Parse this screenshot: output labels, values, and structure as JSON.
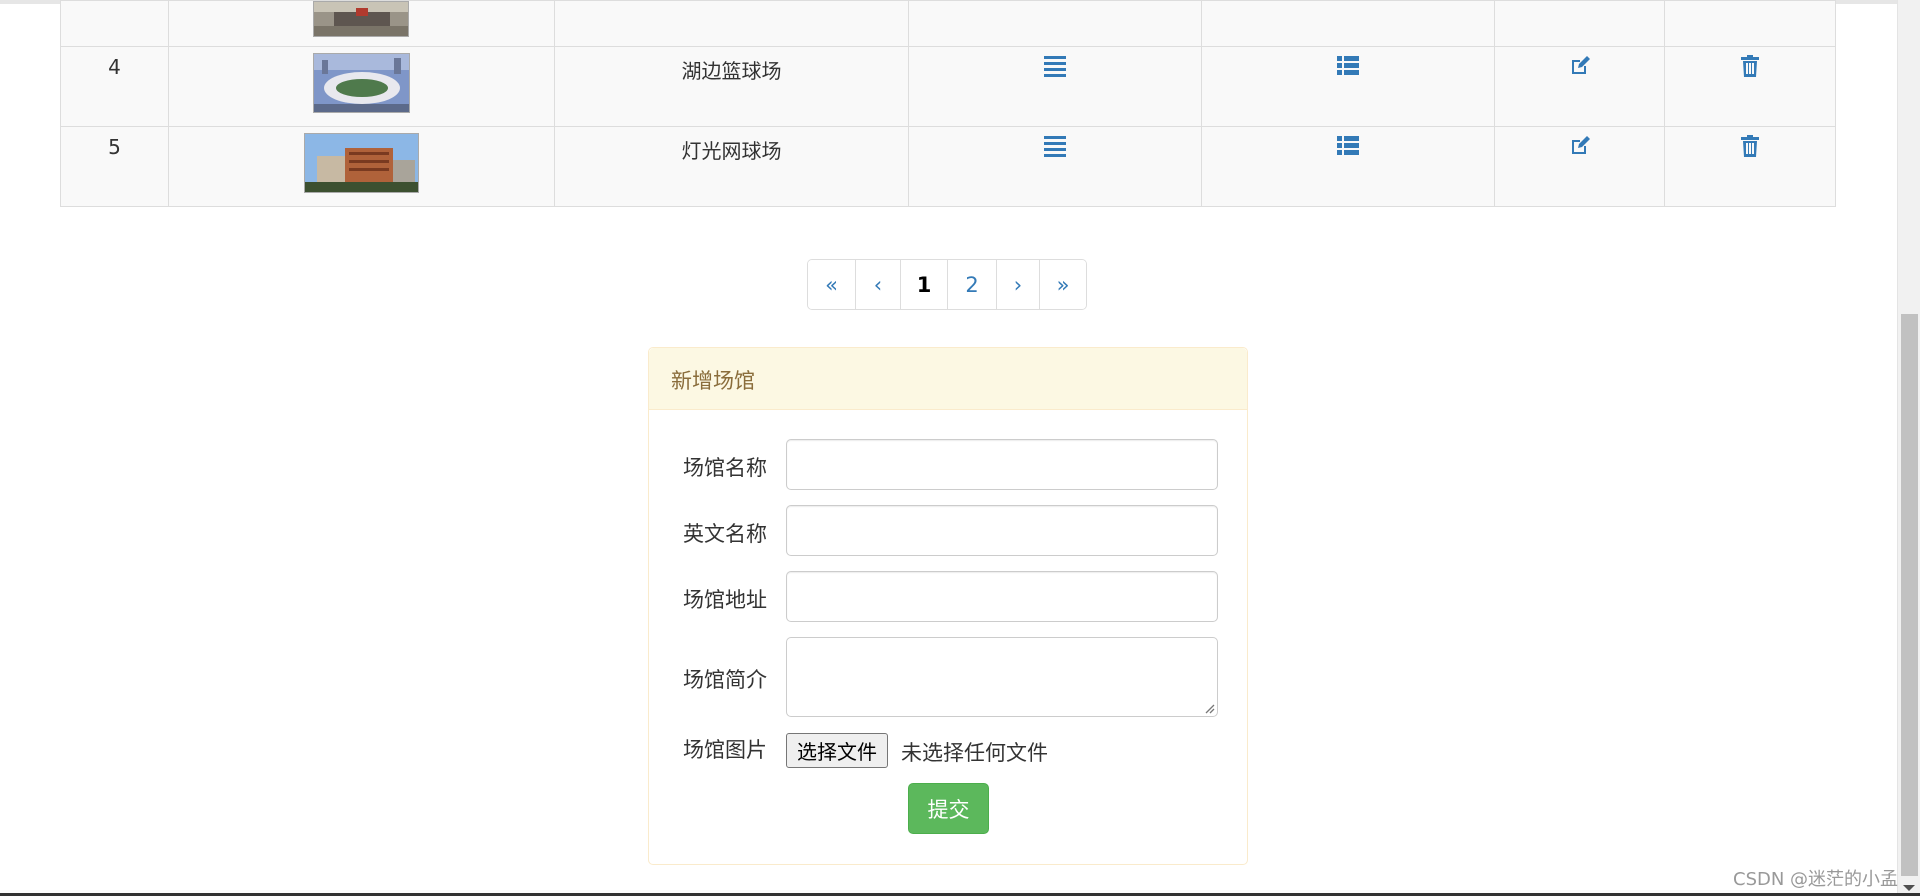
{
  "table": {
    "rows": [
      {
        "num": "",
        "name": "",
        "photo": "stadium-entrance"
      },
      {
        "num": "4",
        "name": "湖边篮球场",
        "photo": "stadium-aerial"
      },
      {
        "num": "5",
        "name": "灯光网球场",
        "photo": "building-exterior"
      }
    ],
    "icons": {
      "detail": "align-justify-icon",
      "list": "list-icon",
      "edit": "edit-icon",
      "delete": "trash-icon"
    }
  },
  "pagination": {
    "first": "«",
    "prev": "‹",
    "pages": [
      "1",
      "2"
    ],
    "active": "1",
    "next": "›",
    "last": "»"
  },
  "form": {
    "title": "新增场馆",
    "name_label": "场馆名称",
    "name_value": "",
    "en_name_label": "英文名称",
    "en_name_value": "",
    "address_label": "场馆地址",
    "address_value": "",
    "intro_label": "场馆简介",
    "intro_value": "",
    "image_label": "场馆图片",
    "file_button": "选择文件",
    "file_status": "未选择任何文件",
    "submit": "提交"
  },
  "watermark": "CSDN @迷茫的小孟",
  "colors": {
    "link": "#337ab7",
    "panel_heading_bg": "#fcf8e3",
    "panel_heading_text": "#8a6d3b",
    "panel_border": "#faebcc",
    "success": "#5cb85c"
  }
}
